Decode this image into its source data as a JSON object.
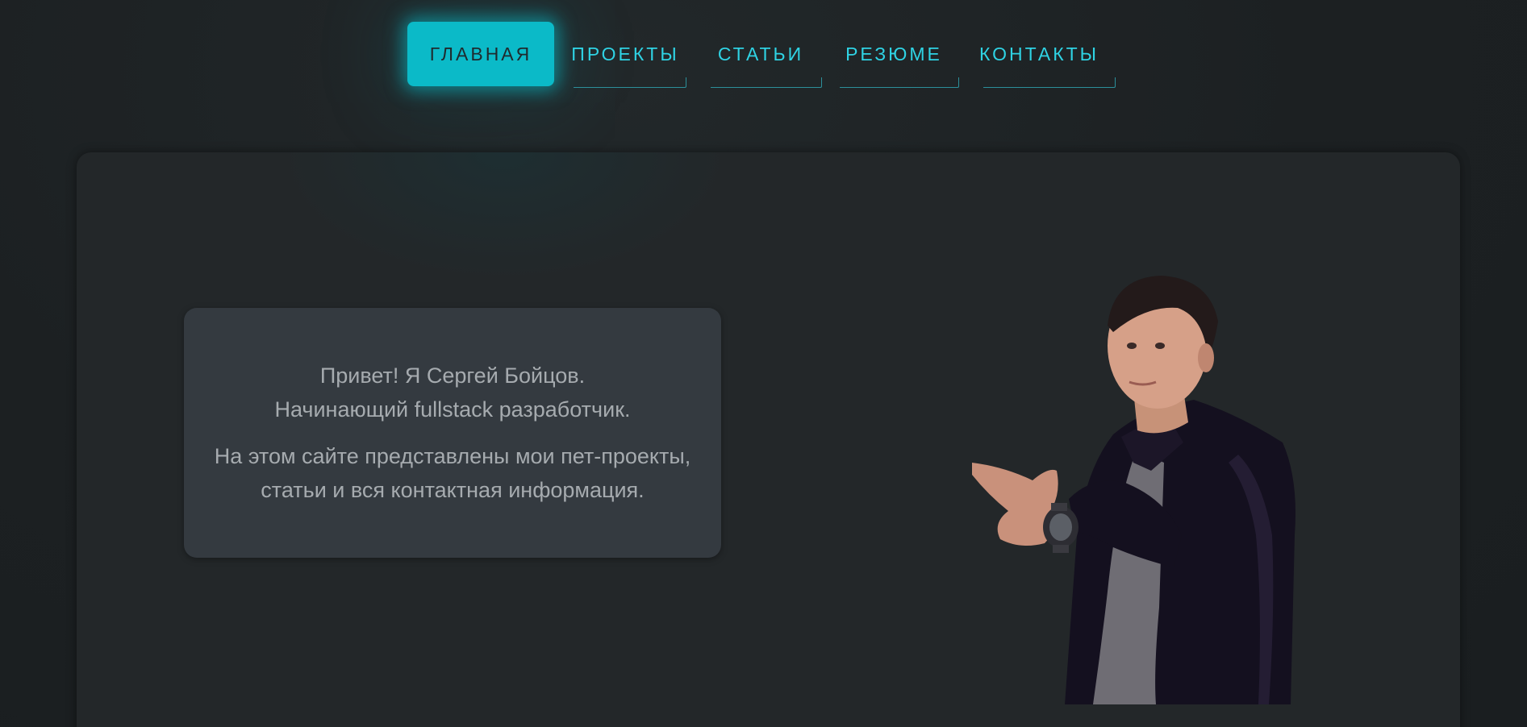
{
  "nav": {
    "items": [
      {
        "label": "ГЛАВНАЯ",
        "active": true
      },
      {
        "label": "ПРОЕКТЫ",
        "active": false
      },
      {
        "label": "СТАТЬИ",
        "active": false
      },
      {
        "label": "РЕЗЮМЕ",
        "active": false
      },
      {
        "label": "КОНТАКТЫ",
        "active": false
      }
    ]
  },
  "intro": {
    "line1": "Привет! Я Сергей Бойцов.",
    "line2": "Начинающий fullstack разработчик.",
    "line3": "На этом сайте представлены мои пет-проекты,",
    "line4": "статьи и вся контактная информация."
  },
  "colors": {
    "accent": "#0bbac8",
    "nav_text": "#2fd3e4",
    "background": "#1c2022",
    "panel": "#232729",
    "card": "#343a40",
    "text": "#a6abaf"
  }
}
